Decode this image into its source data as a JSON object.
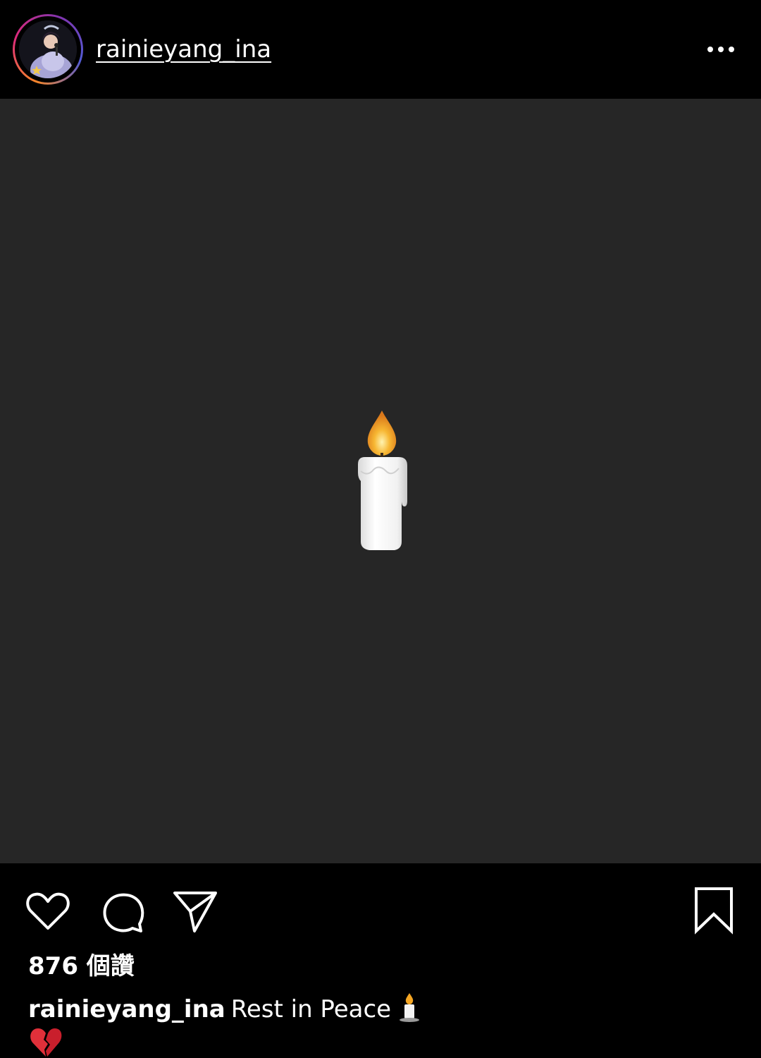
{
  "header": {
    "username": "rainieyang_ina",
    "avatar_icon": "profile-photo",
    "more_icon": "more-horizontal-icon"
  },
  "post": {
    "image_icon": "candle-emoji",
    "background": "#262626"
  },
  "actions": {
    "like_icon": "heart-outline-icon",
    "comment_icon": "comment-bubble-icon",
    "share_icon": "paper-plane-icon",
    "save_icon": "bookmark-outline-icon"
  },
  "likes": {
    "text": "876 個讚"
  },
  "caption": {
    "username": "rainieyang_ina",
    "text": "Rest in Peace",
    "emoji_1": "candle-emoji",
    "emoji_2": "broken-heart-emoji"
  },
  "colors": {
    "background": "#000000",
    "media_background": "#262626",
    "text": "#ffffff",
    "flame": "#f5a623",
    "broken_heart": "#e0303a"
  }
}
